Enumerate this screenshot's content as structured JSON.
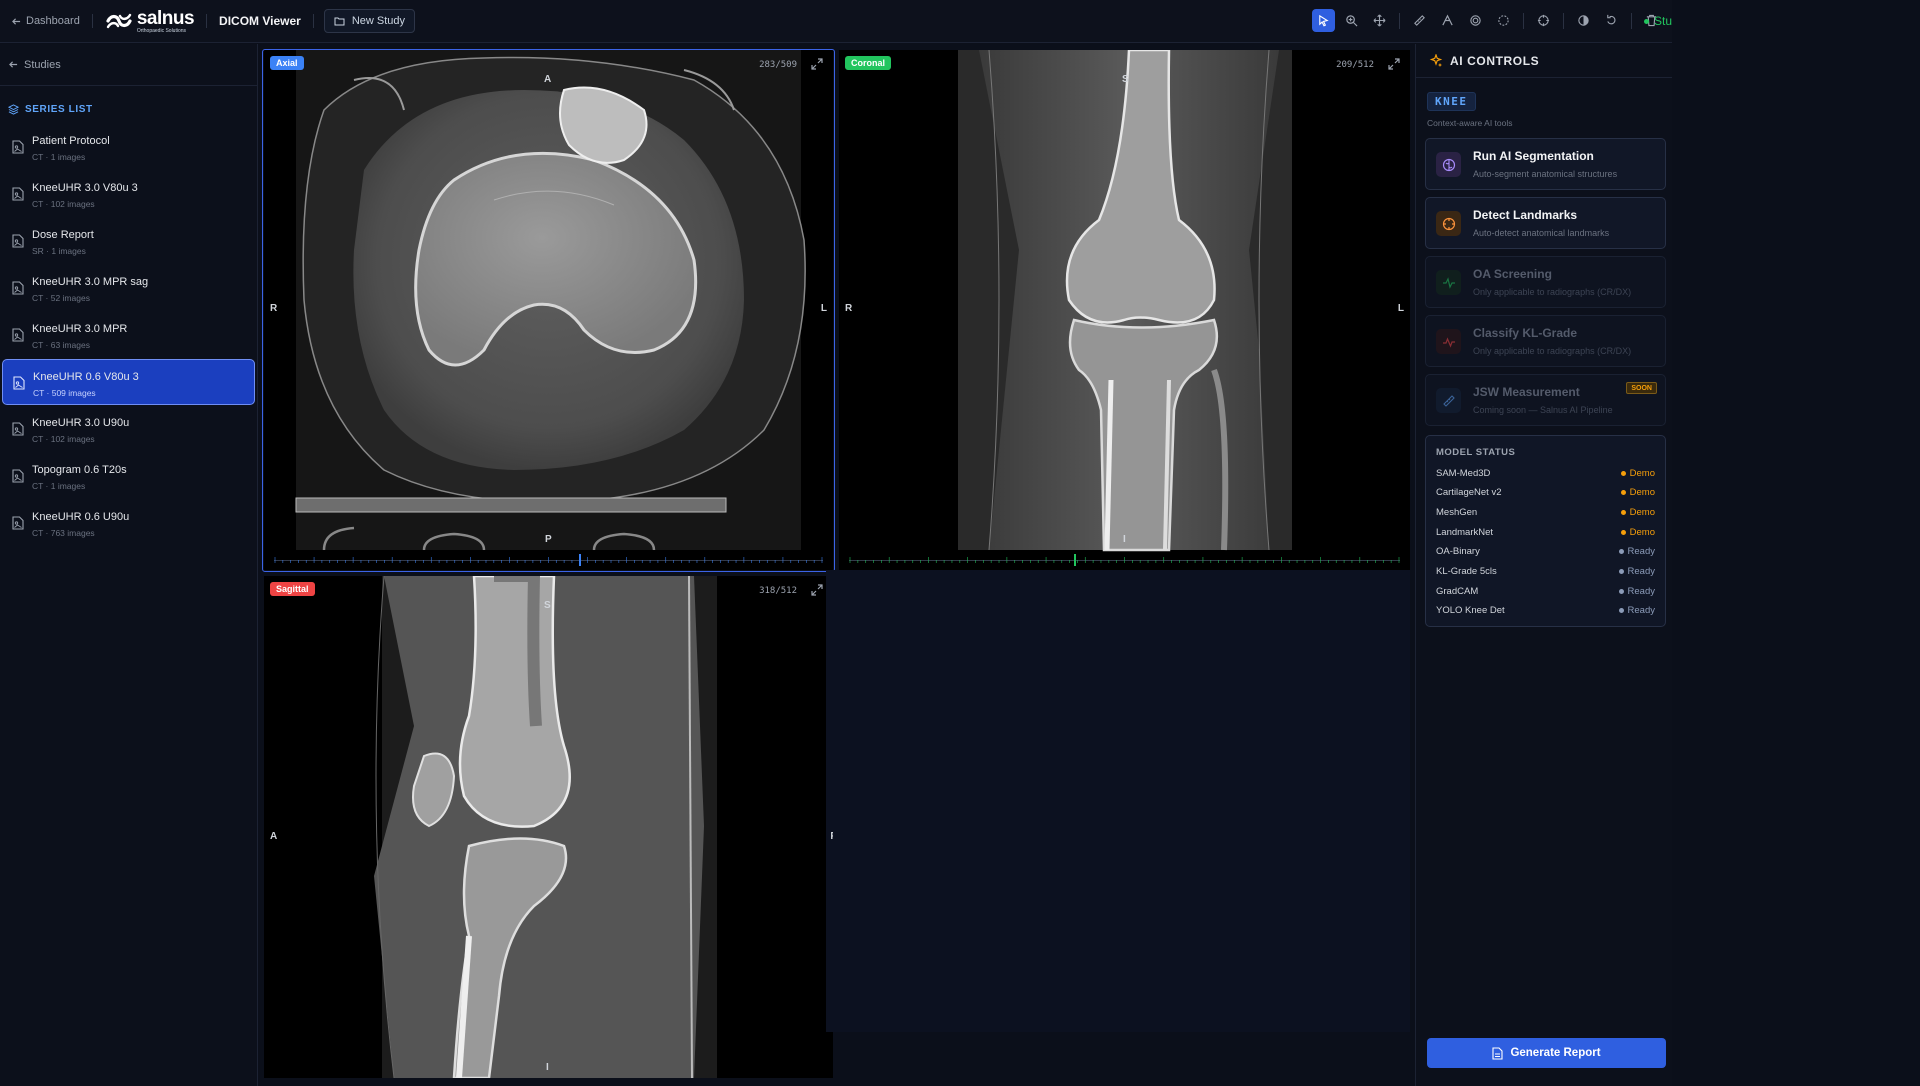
{
  "topbar": {
    "back_label": "Dashboard",
    "brand_name": "salnus",
    "brand_sub": "Orthopaedic Solutions",
    "title": "DICOM Viewer",
    "new_study_label": "New Study",
    "status_label": "Stu"
  },
  "tools": [
    "pointer-icon",
    "zoom-icon",
    "pan-icon",
    "ruler-icon",
    "angle-icon",
    "roi-ellipse-icon",
    "roi-freehand-icon",
    "crosshair-icon",
    "invert-icon",
    "reset-icon",
    "trash-icon"
  ],
  "sidebar": {
    "studies_label": "Studies",
    "section_label": "SERIES LIST",
    "series": [
      {
        "name": "Patient Protocol",
        "meta": "CT · 1 images"
      },
      {
        "name": "KneeUHR 3.0 V80u 3",
        "meta": "CT · 102 images"
      },
      {
        "name": "Dose Report",
        "meta": "SR · 1 images"
      },
      {
        "name": "KneeUHR 3.0 MPR sag",
        "meta": "CT · 52 images"
      },
      {
        "name": "KneeUHR 3.0 MPR",
        "meta": "CT · 63 images"
      },
      {
        "name": "KneeUHR 0.6 V80u 3",
        "meta": "CT · 509 images",
        "selected": true
      },
      {
        "name": "KneeUHR 3.0 U90u",
        "meta": "CT · 102 images"
      },
      {
        "name": "Topogram 0.6 T20s",
        "meta": "CT · 1 images"
      },
      {
        "name": "KneeUHR 0.6 U90u",
        "meta": "CT · 763 images"
      }
    ]
  },
  "viewports": {
    "axial": {
      "label": "Axial",
      "count": "283/509",
      "color": "#3b82f6",
      "orient": {
        "top": "A",
        "bottom": "P",
        "left": "R",
        "right": "L"
      },
      "slice": 283,
      "total": 509
    },
    "coronal": {
      "label": "Coronal",
      "count": "209/512",
      "color": "#22c55e",
      "orient": {
        "top": "S",
        "bottom": "I",
        "left": "R",
        "right": "L"
      },
      "slice": 209,
      "total": 512
    },
    "sagittal": {
      "label": "Sagittal",
      "count": "318/512",
      "color": "#ef4444",
      "orient": {
        "top": "S",
        "bottom": "I",
        "left": "A",
        "right": "P"
      }
    }
  },
  "ai": {
    "title": "AI CONTROLS",
    "tag": "KNEE",
    "context": "Context-aware AI tools",
    "cards": [
      {
        "title": "Run AI Segmentation",
        "desc": "Auto-segment anatomical structures",
        "icon": "brain-icon",
        "enabled": true
      },
      {
        "title": "Detect Landmarks",
        "desc": "Auto-detect anatomical landmarks",
        "icon": "target-icon",
        "enabled": true
      },
      {
        "title": "OA Screening",
        "desc": "Only applicable to radiographs (CR/DX)",
        "icon": "activity-icon",
        "enabled": false
      },
      {
        "title": "Classify KL-Grade",
        "desc": "Only applicable to radiographs (CR/DX)",
        "icon": "pulse-icon",
        "enabled": false
      },
      {
        "title": "JSW Measurement",
        "desc": "Coming soon — Salnus AI Pipeline",
        "icon": "ruler-icon",
        "enabled": false,
        "badge": "SOON"
      }
    ],
    "model_status_title": "MODEL STATUS",
    "models": [
      {
        "name": "SAM-Med3D",
        "status": "Demo"
      },
      {
        "name": "CartilageNet v2",
        "status": "Demo"
      },
      {
        "name": "MeshGen",
        "status": "Demo"
      },
      {
        "name": "LandmarkNet",
        "status": "Demo"
      },
      {
        "name": "OA-Binary",
        "status": "Ready"
      },
      {
        "name": "KL-Grade 5cls",
        "status": "Ready"
      },
      {
        "name": "GradCAM",
        "status": "Ready"
      },
      {
        "name": "YOLO Knee Det",
        "status": "Ready"
      }
    ],
    "status_colors": {
      "Demo": "#f59e0b",
      "Ready": "#8b9bb8"
    },
    "generate_label": "Generate Report"
  },
  "colors": {
    "accent": "#2f5fe0",
    "status_ok": "#22c55e"
  }
}
